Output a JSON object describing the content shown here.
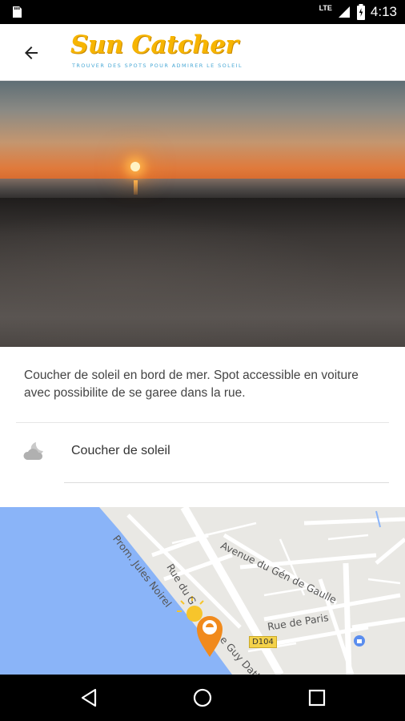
{
  "status_bar": {
    "network": "LTE",
    "time": "4:13",
    "icons": [
      "sd-card-icon",
      "signal-icon",
      "battery-icon"
    ]
  },
  "app_bar": {
    "back_icon": "arrow-back-icon",
    "logo_title": "Sun Catcher",
    "logo_subtitle": "TROUVER DES SPOTS POUR ADMIRER LE SOLEIL"
  },
  "spot": {
    "description": "Coucher de soleil en bord de mer. Spot accessible en voiture avec possibilite de se garee dans la rue.",
    "category_icon": "sunset-cloud-icon",
    "category_label": "Coucher de soleil"
  },
  "map": {
    "labels": {
      "promenade": "Prom. Jules Noirel",
      "rue_du": "Rue du G",
      "avenue": "Avenue du Gén de Gaulle",
      "rue_paris": "Rue de Paris",
      "guy": "e Guy Dath",
      "road_badge": "D104"
    },
    "marker_icon": "sun-marker-icon",
    "shop_icon": "shopping-icon",
    "colors": {
      "water": "#8ab4f8",
      "marker": "#f18a1c",
      "sun": "#f7c52b"
    }
  },
  "nav_bar": {
    "back": "nav-back-icon",
    "home": "nav-home-icon",
    "recents": "nav-recents-icon"
  }
}
